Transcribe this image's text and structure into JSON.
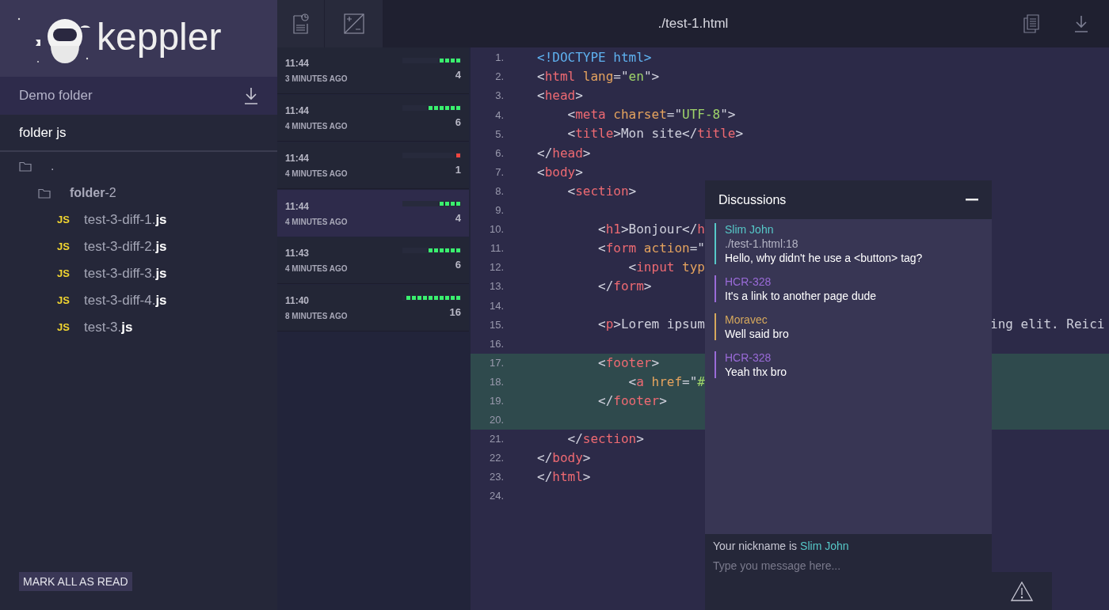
{
  "sidebar": {
    "logo_text": "keppler",
    "project": "Demo folder",
    "folder_title": "folder js",
    "tree": [
      {
        "label": ".",
        "kind": "folder",
        "children": [
          {
            "label": "**folder**-2",
            "kind": "folder",
            "children": [
              {
                "label": "test-3-diff-1.**js**",
                "kind": "file",
                "badge": "JS"
              },
              {
                "label": "test-3-diff-2.**js**",
                "kind": "file",
                "badge": "JS"
              },
              {
                "label": "test-3-diff-3.**js**",
                "kind": "file",
                "badge": "JS"
              },
              {
                "label": "test-3-diff-4.**js**",
                "kind": "file",
                "badge": "JS"
              },
              {
                "label": "test-3.**js**",
                "kind": "file",
                "badge": "JS"
              }
            ]
          }
        ]
      }
    ],
    "mark_all_button": "MARK ALL AS READ"
  },
  "history": [
    {
      "time": "11:44",
      "ago": "3 MINUTES AGO",
      "count": "4",
      "level": 0.4,
      "color": "#3af06e",
      "selected": false
    },
    {
      "time": "11:44",
      "ago": "4 MINUTES AGO",
      "count": "6",
      "level": 0.6,
      "color": "#3af06e",
      "selected": false
    },
    {
      "time": "11:44",
      "ago": "4 MINUTES AGO",
      "count": "1",
      "level": 0.1,
      "color": "#f0453f",
      "selected": false
    },
    {
      "time": "11:44",
      "ago": "4 MINUTES AGO",
      "count": "4",
      "level": 0.4,
      "color": "#3af06e",
      "selected": true
    },
    {
      "time": "11:43",
      "ago": "4 MINUTES AGO",
      "count": "6",
      "level": 0.6,
      "color": "#3af06e",
      "selected": false
    },
    {
      "time": "11:40",
      "ago": "8 MINUTES AGO",
      "count": "16",
      "level": 1.0,
      "color": "#3af06e",
      "selected": false
    }
  ],
  "editor": {
    "file_title": "./test-1.html",
    "lines": [
      {
        "number": "1.",
        "highlighted": false,
        "tokens": [
          {
            "kind": "doctype",
            "text": "<!DOCTYPE html>"
          }
        ]
      },
      {
        "number": "2.",
        "highlighted": false,
        "tokens": [
          {
            "kind": "punct",
            "text": "<"
          },
          {
            "kind": "tag",
            "text": "html"
          },
          {
            "kind": "attr",
            "text": " lang"
          },
          {
            "kind": "punct",
            "text": "=\""
          },
          {
            "kind": "string",
            "text": "en"
          },
          {
            "kind": "punct",
            "text": "\">"
          }
        ]
      },
      {
        "number": "3.",
        "highlighted": false,
        "tokens": [
          {
            "kind": "punct",
            "text": "<"
          },
          {
            "kind": "tag",
            "text": "head"
          },
          {
            "kind": "punct",
            "text": ">"
          }
        ]
      },
      {
        "number": "4.",
        "highlighted": false,
        "tokens": [
          {
            "kind": "punct",
            "text": "    <"
          },
          {
            "kind": "tag",
            "text": "meta"
          },
          {
            "kind": "attr",
            "text": " charset"
          },
          {
            "kind": "punct",
            "text": "=\""
          },
          {
            "kind": "string",
            "text": "UTF-8"
          },
          {
            "kind": "punct",
            "text": "\">"
          }
        ]
      },
      {
        "number": "5.",
        "highlighted": false,
        "tokens": [
          {
            "kind": "punct",
            "text": "    <"
          },
          {
            "kind": "tag",
            "text": "title"
          },
          {
            "kind": "punct",
            "text": ">Mon site</"
          },
          {
            "kind": "tag",
            "text": "title"
          },
          {
            "kind": "punct",
            "text": ">"
          }
        ]
      },
      {
        "number": "6.",
        "highlighted": false,
        "tokens": [
          {
            "kind": "punct",
            "text": "</"
          },
          {
            "kind": "tag",
            "text": "head"
          },
          {
            "kind": "punct",
            "text": ">"
          }
        ]
      },
      {
        "number": "7.",
        "highlighted": false,
        "tokens": [
          {
            "kind": "punct",
            "text": "<"
          },
          {
            "kind": "tag",
            "text": "body"
          },
          {
            "kind": "punct",
            "text": ">"
          }
        ]
      },
      {
        "number": "8.",
        "highlighted": false,
        "tokens": [
          {
            "kind": "punct",
            "text": "    <"
          },
          {
            "kind": "tag",
            "text": "section"
          },
          {
            "kind": "punct",
            "text": ">"
          }
        ]
      },
      {
        "number": "9.",
        "highlighted": false
      },
      {
        "number": "10.",
        "highlighted": false,
        "tokens": [
          {
            "kind": "punct",
            "text": "        <"
          },
          {
            "kind": "tag",
            "text": "h1"
          },
          {
            "kind": "punct",
            "text": ">Bonjour</"
          },
          {
            "kind": "tag",
            "text": "h"
          }
        ]
      },
      {
        "number": "11.",
        "highlighted": false,
        "tokens": [
          {
            "kind": "punct",
            "text": "        <"
          },
          {
            "kind": "tag",
            "text": "form"
          },
          {
            "kind": "attr",
            "text": " action"
          },
          {
            "kind": "punct",
            "text": "=\""
          }
        ]
      },
      {
        "number": "12.",
        "highlighted": false,
        "tokens": [
          {
            "kind": "punct",
            "text": "            <"
          },
          {
            "kind": "tag",
            "text": "input"
          },
          {
            "kind": "attr",
            "text": " typ"
          }
        ]
      },
      {
        "number": "13.",
        "highlighted": false,
        "tokens": [
          {
            "kind": "punct",
            "text": "        </"
          },
          {
            "kind": "tag",
            "text": "form"
          },
          {
            "kind": "punct",
            "text": ">"
          }
        ]
      },
      {
        "number": "14.",
        "highlighted": false
      },
      {
        "number": "15.",
        "highlighted": false,
        "tokens": [
          {
            "kind": "punct",
            "text": "        <"
          },
          {
            "kind": "tag",
            "text": "p"
          },
          {
            "kind": "punct",
            "text": ">Lorem ipsum"
          }
        ],
        "tail": "ing elit. Reici"
      },
      {
        "number": "16.",
        "highlighted": false
      },
      {
        "number": "17.",
        "highlighted": true,
        "tokens": [
          {
            "kind": "punct",
            "text": "        <"
          },
          {
            "kind": "tag",
            "text": "footer"
          },
          {
            "kind": "punct",
            "text": ">"
          }
        ]
      },
      {
        "number": "18.",
        "highlighted": true,
        "tokens": [
          {
            "kind": "punct",
            "text": "            <"
          },
          {
            "kind": "tag",
            "text": "a"
          },
          {
            "kind": "attr",
            "text": " href"
          },
          {
            "kind": "punct",
            "text": "=\""
          },
          {
            "kind": "string",
            "text": "#"
          }
        ]
      },
      {
        "number": "19.",
        "highlighted": true,
        "tokens": [
          {
            "kind": "punct",
            "text": "        </"
          },
          {
            "kind": "tag",
            "text": "footer"
          },
          {
            "kind": "punct",
            "text": ">"
          }
        ]
      },
      {
        "number": "20.",
        "highlighted": true
      },
      {
        "number": "21.",
        "highlighted": false,
        "tokens": [
          {
            "kind": "punct",
            "text": "    </"
          },
          {
            "kind": "tag",
            "text": "section"
          },
          {
            "kind": "punct",
            "text": ">"
          }
        ]
      },
      {
        "number": "22.",
        "highlighted": false,
        "tokens": [
          {
            "kind": "punct",
            "text": "</"
          },
          {
            "kind": "tag",
            "text": "body"
          },
          {
            "kind": "punct",
            "text": ">"
          }
        ]
      },
      {
        "number": "23.",
        "highlighted": false,
        "tokens": [
          {
            "kind": "punct",
            "text": "</"
          },
          {
            "kind": "tag",
            "text": "html"
          },
          {
            "kind": "punct",
            "text": ">"
          }
        ]
      },
      {
        "number": "24.",
        "highlighted": false
      }
    ]
  },
  "discussions": {
    "title": "Discussions",
    "messages": [
      {
        "author": "Slim John",
        "color": "#56c8c8",
        "ref": "./test-1.html:18",
        "text": "Hello, why didn't he use a <button> tag?"
      },
      {
        "author": "HCR-328",
        "color": "#9a6bd8",
        "text": "It's a link to another page dude"
      },
      {
        "author": "Moravec",
        "color": "#d6a85c",
        "text": "Well said bro"
      },
      {
        "author": "HCR-328",
        "color": "#9a6bd8",
        "text": "Yeah thx bro"
      }
    ],
    "nickname_label": "Your nickname is",
    "nickname": "Slim John",
    "input": {
      "placeholder": "Type you message here..."
    }
  }
}
